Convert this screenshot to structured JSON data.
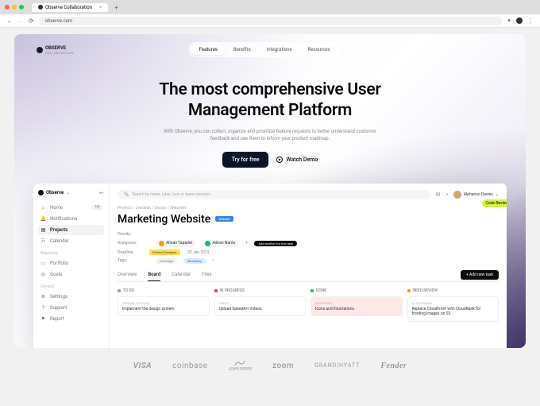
{
  "browser": {
    "tab_title": "Observe Collaboration",
    "url": "observe.com"
  },
  "nav": {
    "brand": "OBSERVE",
    "brand_sub": "COLLABORATION",
    "links": [
      "Features",
      "Benefits",
      "Integrations",
      "Resources"
    ]
  },
  "hero": {
    "h1_line1": "The most comprehensive User",
    "h1_line2": "Management Platform",
    "sub": "With Observe, you can collect, organize and prioritize feature requests to better understand customer feedback and use them to inform your product roadmap.",
    "cta_primary": "Try for free",
    "cta_secondary": "Watch Demo"
  },
  "app": {
    "brand": "Observe",
    "search_placeholder": "Search by name, label, task or team member...",
    "user_name": "Alphanso Davies",
    "badge_label": "Code Reviewers",
    "sidebar": {
      "items": [
        {
          "icon": "⌂",
          "label": "Home",
          "badge": "14"
        },
        {
          "icon": "🔔",
          "label": "Notifications"
        },
        {
          "icon": "▤",
          "label": "Projects"
        },
        {
          "icon": "☷",
          "label": "Calender"
        }
      ],
      "section1": "Reporting",
      "items2": [
        {
          "icon": "▭",
          "label": "Portfolio"
        },
        {
          "icon": "◎",
          "label": "Goals"
        }
      ],
      "section2": "General",
      "items3": [
        {
          "icon": "⚙",
          "label": "Settings"
        },
        {
          "icon": "?",
          "label": "Support"
        },
        {
          "icon": "⚑",
          "label": "Report"
        }
      ]
    },
    "crumbs": "Projects / Zendesk / Design / Websites",
    "page_title": "Marketing Website",
    "title_chip": "Website",
    "meta": {
      "priority_label": "Priority:",
      "assignees_label": "Assignees:",
      "assignee1": "Ahsan Tapader",
      "assignee2": "Adnan Nantu",
      "add_another": "Add another for this task",
      "deadline_label": "Deadline:",
      "deadline_value": "23 Jan 2023",
      "designer_chip": "Product Designer",
      "tags_label": "Tags:",
      "tag1": "UI Design",
      "tag2": "Marketing"
    },
    "tabs": [
      "Overview",
      "Board",
      "Calendar",
      "Files"
    ],
    "add_task": "+ Add new task",
    "columns": [
      {
        "name": "TO DO",
        "card_tag": "DESIGN SYSTEM",
        "card_title": "Implement the design system"
      },
      {
        "name": "IN PROGRESS",
        "card_tag": "VIDEO",
        "card_title": "Upload SpeedArt Videos"
      },
      {
        "name": "DONE",
        "card_tag": "GRAPHICS",
        "card_title": "Icons and Illustrations"
      },
      {
        "name": "NEED REVIEW",
        "card_tag": "CLOUDRANK",
        "card_title": "Replace CloudFront with CloudRank for fronting images on S3"
      }
    ]
  },
  "brands": [
    "VISA",
    "coinbase",
    "JOHN DEERE",
    "zoom",
    "GRAND|HYATT",
    "Fender"
  ]
}
